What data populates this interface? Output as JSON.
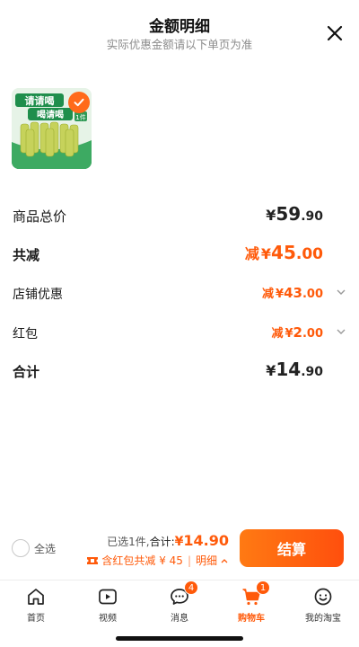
{
  "header": {
    "title": "金额明细",
    "subtitle": "实际优惠金额请以下单页为准",
    "close_icon": "close-icon"
  },
  "product": {
    "thumb_text_top": "请请喝",
    "thumb_text_mid": "喝请喝",
    "thumb_tag": "1件",
    "check_icon": "check-icon"
  },
  "breakdown": {
    "total": {
      "label": "商品总价",
      "currency": "¥",
      "int": "59",
      "dec": ".90"
    },
    "reduce": {
      "label": "共减",
      "prefix": "减",
      "currency": "¥",
      "int": "45",
      "dec": ".00"
    },
    "shop": {
      "label": "店铺优惠",
      "prefix": "减",
      "currency": "¥",
      "int": "43",
      "dec": ".00"
    },
    "redpack": {
      "label": "红包",
      "prefix": "减",
      "currency": "¥",
      "int": "2",
      "dec": ".00"
    },
    "sum": {
      "label": "合计",
      "currency": "¥",
      "int": "14",
      "dec": ".90"
    }
  },
  "checkout": {
    "select_all": "全选",
    "selected": "已选1件,",
    "total_label": "合计:",
    "currency": "¥",
    "amount": "14.90",
    "redpack_note": "含红包共减 ¥ 45",
    "detail_link": "明细",
    "pay_label": "结算",
    "colors": {
      "accent": "#ff5a0a",
      "button_start": "#ff7a13",
      "button_end": "#ff4f0d"
    }
  },
  "tabbar": {
    "items": [
      {
        "label": "首页",
        "icon": "home-icon"
      },
      {
        "label": "视频",
        "icon": "video-icon"
      },
      {
        "label": "消息",
        "icon": "message-icon",
        "badge": "4"
      },
      {
        "label": "购物车",
        "icon": "cart-icon",
        "badge": "1",
        "active": true
      },
      {
        "label": "我的淘宝",
        "icon": "profile-icon"
      }
    ]
  }
}
